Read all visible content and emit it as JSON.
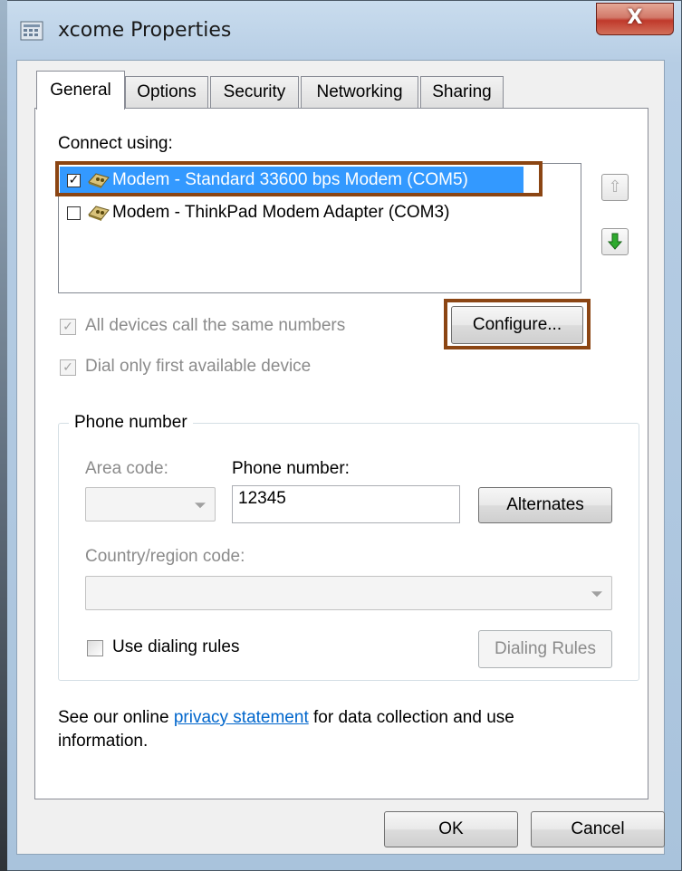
{
  "window": {
    "title": "xcome Properties",
    "close_glyph": "X"
  },
  "tabs": [
    {
      "label": "General",
      "active": true
    },
    {
      "label": "Options",
      "active": false
    },
    {
      "label": "Security",
      "active": false
    },
    {
      "label": "Networking",
      "active": false
    },
    {
      "label": "Sharing",
      "active": false
    }
  ],
  "general": {
    "connect_using_label": "Connect using:",
    "devices": [
      {
        "label": "Modem - Standard 33600 bps Modem (COM5)",
        "checked": true,
        "selected": true
      },
      {
        "label": "Modem - ThinkPad Modem Adapter (COM3)",
        "checked": false,
        "selected": false
      }
    ],
    "all_devices_label": "All devices call the same numbers",
    "all_devices_checked": true,
    "dial_first_label": "Dial only first available device",
    "dial_first_checked": true,
    "configure_button": "Configure...",
    "phone_group_label": "Phone number",
    "area_code_label": "Area code:",
    "area_code_value": "",
    "phone_number_label": "Phone number:",
    "phone_number_value": "12345",
    "alternates_button": "Alternates",
    "country_label": "Country/region code:",
    "country_value": "",
    "use_dialing_rules_label": "Use dialing rules",
    "use_dialing_rules_checked": false,
    "dialing_rules_button": "Dialing Rules",
    "privacy_prefix": "See our online",
    "privacy_link": "privacy statement",
    "privacy_suffix": "for data collection and use",
    "privacy_line2": "information."
  },
  "footer": {
    "ok_button": "OK",
    "cancel_button": "Cancel"
  },
  "colors": {
    "selection": "#3399ff",
    "highlight_outline": "#8b4513",
    "link": "#0066cc",
    "close_button": "#c0392b"
  }
}
